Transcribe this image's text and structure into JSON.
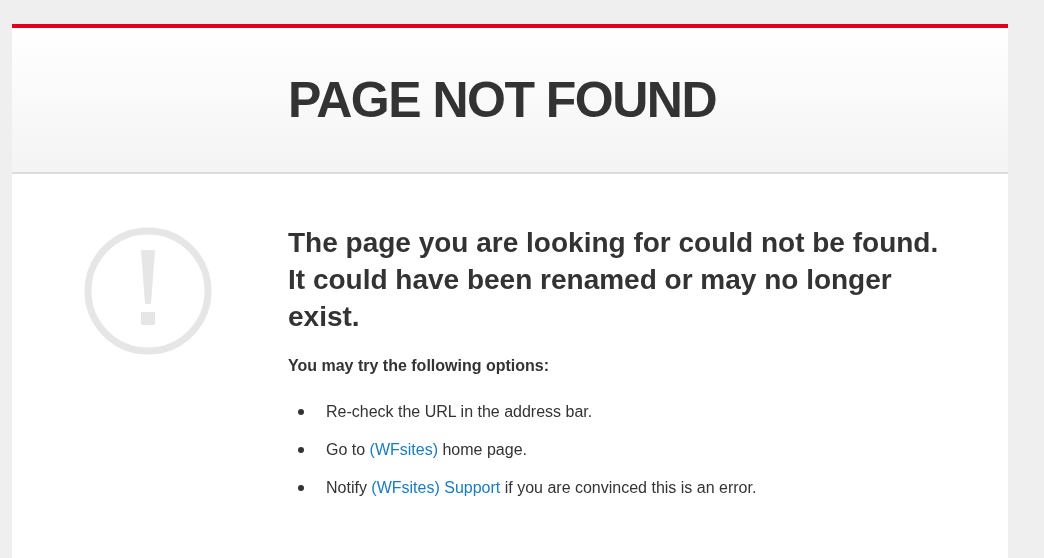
{
  "header": {
    "title": "PAGE NOT FOUND"
  },
  "message": {
    "heading": "The page you are looking for could not be found. It could have been renamed or may no longer exist.",
    "subheading": "You may try the following options:",
    "options": [
      [
        {
          "text": "Re-check the URL in the address bar.",
          "link": false
        }
      ],
      [
        {
          "text": "Go to ",
          "link": false
        },
        {
          "text": "(WFsites)",
          "link": true
        },
        {
          "text": " home page.",
          "link": false
        }
      ],
      [
        {
          "text": "Notify ",
          "link": false
        },
        {
          "text": "(WFsites) Support",
          "link": true
        },
        {
          "text": " if you are convinced this is an error.",
          "link": false
        }
      ]
    ]
  }
}
